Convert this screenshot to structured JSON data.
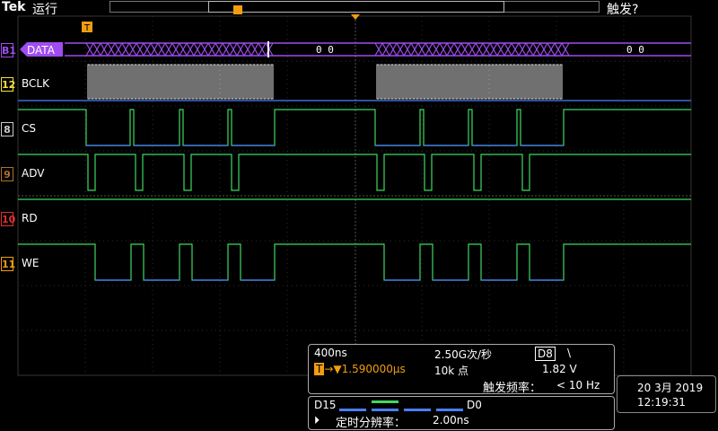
{
  "brand": "Tek",
  "run_state": "运行",
  "trigger_status": "触发?",
  "bus": {
    "label": "DATA",
    "badge": "B1",
    "value1": "0 0",
    "value2": "0 0"
  },
  "channels": [
    {
      "badge": "12",
      "label": "BCLK"
    },
    {
      "badge": "8",
      "label": "CS"
    },
    {
      "badge": "9",
      "label": "ADV"
    },
    {
      "badge": "10",
      "label": "RD"
    },
    {
      "badge": "11",
      "label": "WE"
    }
  ],
  "markers": {
    "trigger": "T"
  },
  "acq": {
    "timebase": "400ns",
    "sample_rate": "2.50G次/秒",
    "trig_channel": "D8",
    "trig_slope": "\\",
    "trig_marker": "T",
    "delay": "1.590000µs",
    "record_length": "10k 点",
    "trig_level": "1.82 V",
    "trig_freq_label": "触发频率：",
    "trig_freq_value": "< 10 Hz"
  },
  "digital": {
    "left_label": "D15",
    "right_label": "D0",
    "resolution_label": "定时分辨率：",
    "resolution_value": "2.00ns"
  },
  "clock": {
    "date": "20 3月 2019",
    "time": "12:19:31"
  },
  "colors": {
    "purple": "#a04cf0",
    "green": "#3fd860",
    "blue": "#4a7fff",
    "white": "#e0e0e0",
    "orange": "#f39c12",
    "yellow": "#f5e23a",
    "red": "#e03030"
  }
}
